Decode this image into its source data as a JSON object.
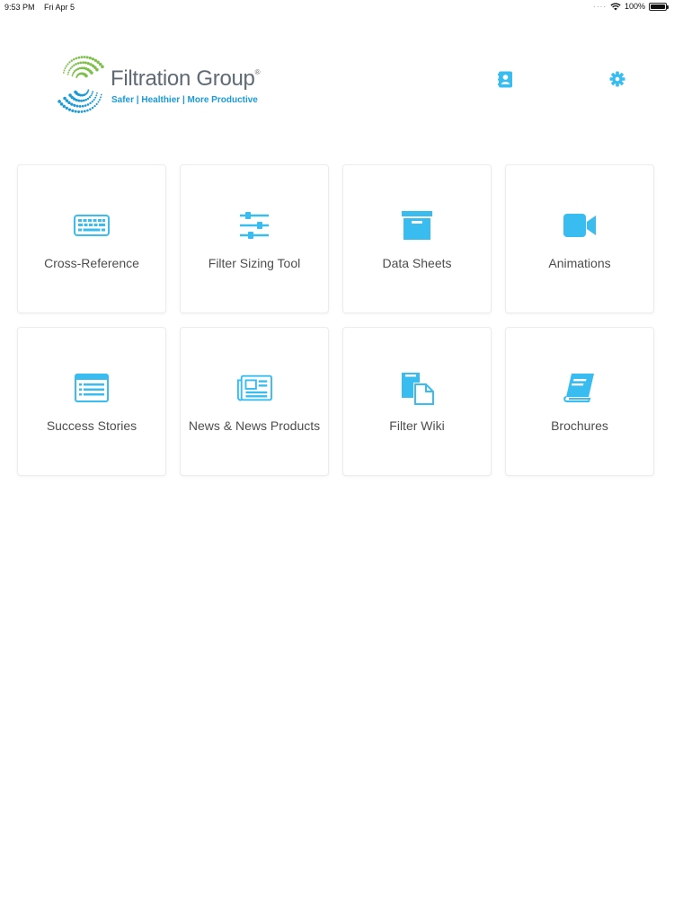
{
  "status_bar": {
    "time": "9:53 PM",
    "date": "Fri Apr 5",
    "battery": "100%",
    "signal_icon": "cellular-dots-icon",
    "wifi_icon": "wifi-icon",
    "battery_icon": "battery-icon"
  },
  "header": {
    "logo": {
      "name": "Filtration Group",
      "registered": "®",
      "tagline": "Safer | Healthier | More Productive"
    },
    "buttons": [
      {
        "icon": "contacts-icon"
      },
      {
        "icon": "gear-icon"
      }
    ]
  },
  "colors": {
    "accent": "#39bdf0",
    "tile_border": "#ececec",
    "logo_text": "#5f6a73",
    "tagline": "#1a9ad6",
    "logo_green": "#7cc04b",
    "logo_blue": "#1a9ad6"
  },
  "tiles": [
    {
      "label": "Cross-Reference",
      "icon": "keyboard-icon"
    },
    {
      "label": "Filter Sizing Tool",
      "icon": "sliders-icon"
    },
    {
      "label": "Data Sheets",
      "icon": "archive-box-icon"
    },
    {
      "label": "Animations",
      "icon": "video-camera-icon"
    },
    {
      "label": "Success Stories",
      "icon": "list-window-icon"
    },
    {
      "label": "News & News Products",
      "icon": "newspaper-icon"
    },
    {
      "label": "Filter Wiki",
      "icon": "documents-icon"
    },
    {
      "label": "Brochures",
      "icon": "book-icon"
    }
  ]
}
